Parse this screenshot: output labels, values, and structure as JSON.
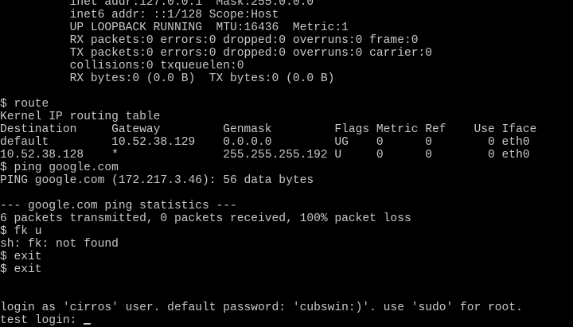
{
  "colors": {
    "background": "#000000",
    "foreground": "#c8c8c8"
  },
  "terminal": {
    "lines": [
      "          inet addr:127.0.0.1  Mask:255.0.0.0",
      "          inet6 addr: ::1/128 Scope:Host",
      "          UP LOOPBACK RUNNING  MTU:16436  Metric:1",
      "          RX packets:0 errors:0 dropped:0 overruns:0 frame:0",
      "          TX packets:0 errors:0 dropped:0 overruns:0 carrier:0",
      "          collisions:0 txqueuelen:0",
      "          RX bytes:0 (0.0 B)  TX bytes:0 (0.0 B)",
      "",
      "$ route",
      "Kernel IP routing table",
      "Destination     Gateway         Genmask         Flags Metric Ref    Use Iface",
      "default         10.52.38.129    0.0.0.0         UG    0      0        0 eth0",
      "10.52.38.128    *               255.255.255.192 U     0      0        0 eth0",
      "$ ping google.com",
      "PING google.com (172.217.3.46): 56 data bytes",
      "",
      "--- google.com ping statistics ---",
      "6 packets transmitted, 0 packets received, 100% packet loss",
      "$ fk u",
      "sh: fk: not found",
      "$ exit",
      "$ exit",
      "",
      "",
      "login as 'cirros' user. default password: 'cubswin:)'. use 'sudo' for root."
    ],
    "prompt_line": "test login: "
  }
}
